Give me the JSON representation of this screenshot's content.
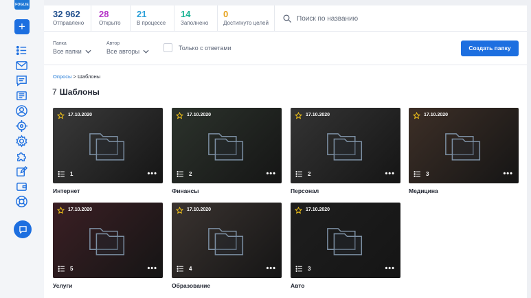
{
  "brand": {
    "logo_text": "FOGLIE"
  },
  "sidebar": {
    "add_label": "+",
    "icons": [
      "surveys-list-icon",
      "mail-icon",
      "chat-message-icon",
      "newspaper-icon",
      "user-icon",
      "target-icon",
      "gear-icon",
      "puzzle-icon",
      "edit-icon",
      "wallet-icon",
      "lifebuoy-icon"
    ]
  },
  "stats": [
    {
      "value": "32 962",
      "label": "Отправлено",
      "color": "#1f4e8c"
    },
    {
      "value": "28",
      "label": "Открыто",
      "color": "#b533c8"
    },
    {
      "value": "21",
      "label": "В процессе",
      "color": "#2a9fd8"
    },
    {
      "value": "14",
      "label": "Заполнено",
      "color": "#1ab394"
    },
    {
      "value": "0",
      "label": "Достигнуто целей",
      "color": "#e5a11a"
    }
  ],
  "search": {
    "placeholder": "Поиск по названию"
  },
  "filters": {
    "folder": {
      "label": "Папка",
      "value": "Все папки"
    },
    "author": {
      "label": "Автор",
      "value": "Все авторы"
    },
    "only_answers": {
      "label": "Только с ответами",
      "checked": false
    }
  },
  "create_button": "Создать папку",
  "breadcrumb": {
    "root": "Опросы",
    "separator": ">",
    "current": "Шаблоны"
  },
  "heading": {
    "count": "7",
    "title": "Шаблоны"
  },
  "cards": [
    {
      "title": "Интернет",
      "date": "17.10.2020",
      "count": "1",
      "more": "•••",
      "bg": "#3a3a3a"
    },
    {
      "title": "Финансы",
      "date": "17.10.2020",
      "count": "2",
      "more": "•••",
      "bg": "#2c332c"
    },
    {
      "title": "Персонал",
      "date": "17.10.2020",
      "count": "2",
      "more": "•••",
      "bg": "#343434"
    },
    {
      "title": "Медицина",
      "date": "17.10.2020",
      "count": "3",
      "more": "•••",
      "bg": "#3d2f27"
    },
    {
      "title": "Услуги",
      "date": "17.10.2020",
      "count": "5",
      "more": "•••",
      "bg": "#3b1f24"
    },
    {
      "title": "Образование",
      "date": "17.10.2020",
      "count": "4",
      "more": "•••",
      "bg": "#3a3330"
    },
    {
      "title": "Авто",
      "date": "17.10.2020",
      "count": "3",
      "more": "•••",
      "bg": "#1e1e1e"
    }
  ]
}
